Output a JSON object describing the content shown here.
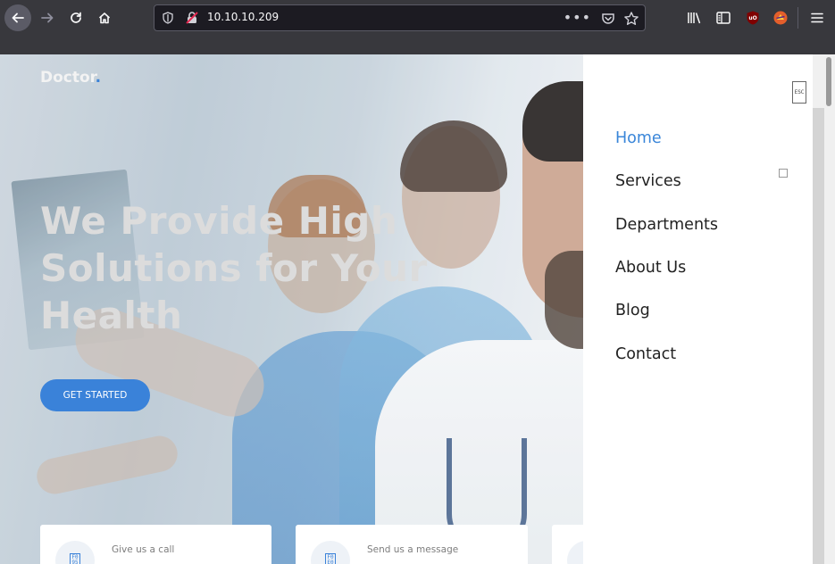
{
  "browser": {
    "url": "10.10.10.209",
    "overflow_label": "•••"
  },
  "site": {
    "logo_text": "Doctor",
    "logo_dot": ".",
    "hero_title_lines": [
      "We Provide High",
      "Solutions for Your",
      "Health"
    ],
    "cta_label": "GET STARTED",
    "info_cards": [
      {
        "label": "Give us a call",
        "icon": "phone-icon"
      },
      {
        "label": "Send us a message",
        "icon": "mail-icon"
      },
      {
        "label": "",
        "icon": "location-icon"
      }
    ]
  },
  "offcanvas": {
    "close_label": "ESC",
    "menu": [
      {
        "label": "Home",
        "active": true
      },
      {
        "label": "Services",
        "has_submenu": true
      },
      {
        "label": "Departments"
      },
      {
        "label": "About Us"
      },
      {
        "label": "Blog"
      },
      {
        "label": "Contact"
      }
    ]
  },
  "colors": {
    "accent": "#3a82d9",
    "chrome": "#38383d",
    "urlbar": "#1c1b22"
  }
}
